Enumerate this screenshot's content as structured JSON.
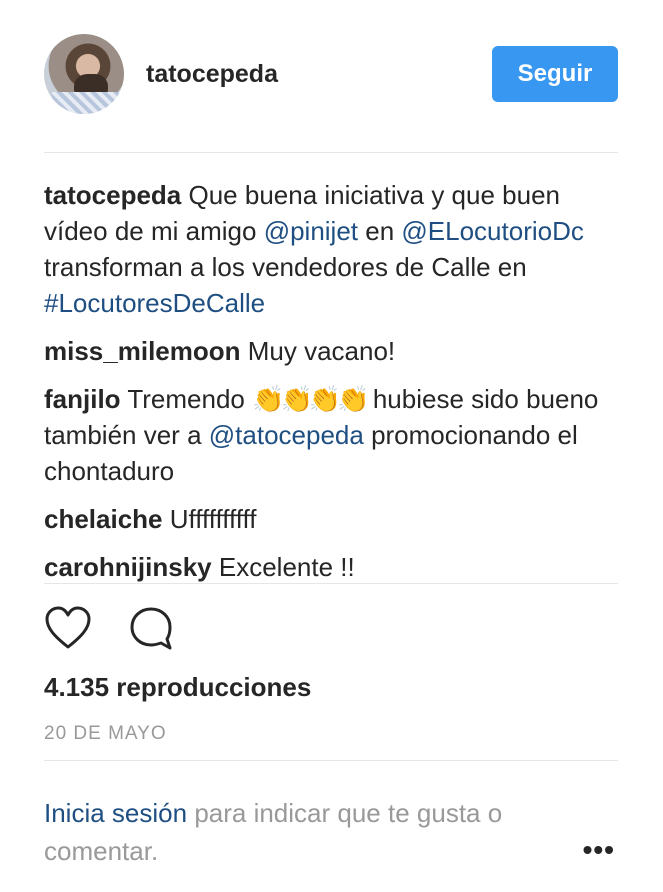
{
  "header": {
    "username": "tatocepeda",
    "follow_label": "Seguir"
  },
  "caption": {
    "user": "tatocepeda",
    "text1": "Que buena iniciativa y que buen vídeo de mi amigo",
    "mention1": "@pinijet",
    "text2": "en",
    "mention2": "@ELocutorioDc",
    "text3": "transforman a los vendedores de Calle en",
    "hashtag": "#LocutoresDeCalle"
  },
  "comments": [
    {
      "user": "miss_milemoon",
      "text": "Muy vacano!"
    },
    {
      "user": "fanjilo",
      "text_before": "Tremendo",
      "emoji": "👏👏👏👏",
      "text_after": "hubiese sido bueno también ver a",
      "mention": "@tatocepeda",
      "text_end": "promocionando el chontaduro"
    },
    {
      "user": "chelaiche",
      "text": "Uffffffffff"
    },
    {
      "user": "carohnijinsky",
      "text": "Excelente !!"
    }
  ],
  "actions": {
    "like_icon": "heart-icon",
    "comment_icon": "comment-bubble-icon"
  },
  "stats": {
    "views": "4.135 reproducciones",
    "date": "20 DE MAYO"
  },
  "login_prompt": {
    "link": "Inicia sesión",
    "text": "para indicar que te gusta o comentar."
  },
  "more_label": "•••",
  "colors": {
    "accent": "#3897f0",
    "link": "#1f4f82",
    "muted": "#999999",
    "text": "#262626"
  }
}
